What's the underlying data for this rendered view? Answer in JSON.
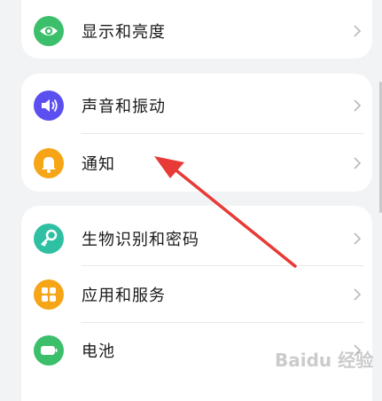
{
  "settings": {
    "items": [
      {
        "label": "显示和亮度",
        "icon": "eye-icon",
        "color": "#3bbf6a"
      },
      {
        "label": "声音和振动",
        "icon": "speaker-icon",
        "color": "#5b4ff0"
      },
      {
        "label": "通知",
        "icon": "bell-icon",
        "color": "#f5a515"
      },
      {
        "label": "生物识别和密码",
        "icon": "key-icon",
        "color": "#2fc0a4"
      },
      {
        "label": "应用和服务",
        "icon": "apps-grid-icon",
        "color": "#f5a515"
      },
      {
        "label": "电池",
        "icon": "battery-icon",
        "color": "#3bbf6a"
      }
    ]
  },
  "annotation": {
    "color": "#e83a36"
  },
  "watermark": {
    "text": "Baidu 经验"
  }
}
